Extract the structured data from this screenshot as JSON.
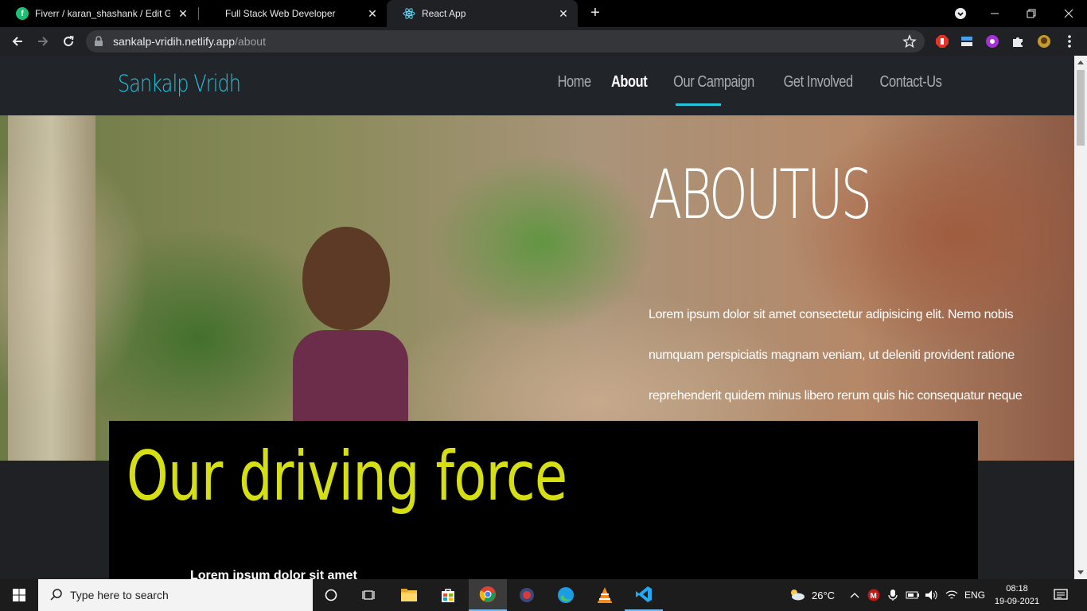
{
  "browser": {
    "tabs": [
      {
        "title": "Fiverr / karan_shashank / Edit Gig",
        "favicon": "fiverr-icon",
        "active": false
      },
      {
        "title": "Full Stack Web Developer",
        "favicon": "",
        "active": false
      },
      {
        "title": "React App",
        "favicon": "react-icon",
        "active": true
      }
    ],
    "close_glyph": "✕",
    "url_host": "sankalp-vridih.netlify.app",
    "url_path": "/about"
  },
  "site": {
    "brand": "Sankalp Vridh",
    "nav": [
      "Home",
      "About",
      "Our Campaign",
      "Get Involved",
      "Contact-Us"
    ],
    "active_nav": "About",
    "accent_color": "#25c4dd",
    "hero_title": "ABOUTUS",
    "hero_text": "Lorem ipsum dolor sit amet consectetur adipisicing elit. Nemo nobis numquam perspiciatis magnam veniam, ut deleniti provident ratione reprehenderit quidem minus libero rerum quis hic consequatur neque tempora. Quibusdam, facilis.",
    "section_title": "Our driving force",
    "section_title_color": "#d6df12",
    "section_sub": "Lorem ipsum dolor sit amet"
  },
  "taskbar": {
    "search_placeholder": "Type here to search",
    "weather": "26°C",
    "language": "ENG",
    "time": "08:18",
    "date": "19-09-2021"
  }
}
